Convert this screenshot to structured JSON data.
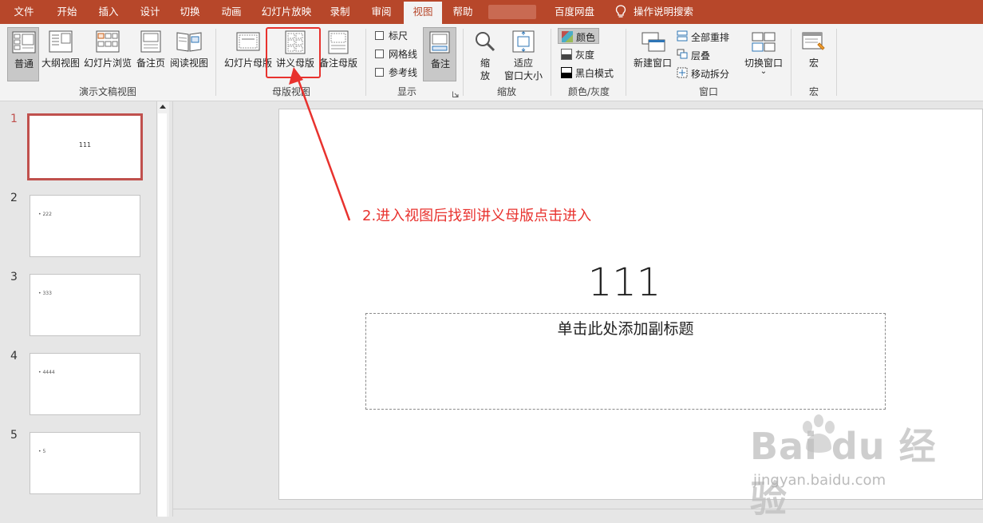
{
  "tabs": [
    {
      "label": "文件"
    },
    {
      "label": "开始"
    },
    {
      "label": "插入"
    },
    {
      "label": "设计"
    },
    {
      "label": "切换"
    },
    {
      "label": "动画"
    },
    {
      "label": "幻灯片放映"
    },
    {
      "label": "录制"
    },
    {
      "label": "审阅"
    },
    {
      "label": "视图"
    },
    {
      "label": "帮助"
    },
    {
      "label": "百度网盘"
    }
  ],
  "tell_me": "操作说明搜索",
  "ribbon": {
    "presentation_views": {
      "label": "演示文稿视图",
      "normal": "普通",
      "outline": "大纲视图",
      "sorter": "幻灯片浏览",
      "notes_page": "备注页",
      "reading": "阅读视图"
    },
    "master_views": {
      "label": "母版视图",
      "slide_master": "幻灯片母版",
      "handout_master": "讲义母版",
      "notes_master": "备注母版"
    },
    "show": {
      "label": "显示",
      "ruler": "标尺",
      "gridlines": "网格线",
      "guides": "参考线",
      "notes": "备注"
    },
    "zoom": {
      "label": "缩放",
      "zoom_line1": "缩",
      "zoom_line2": "放",
      "fit_line1": "适应",
      "fit_line2": "窗口大小"
    },
    "color": {
      "label": "颜色/灰度",
      "color": "颜色",
      "grayscale": "灰度",
      "bw": "黑白模式"
    },
    "window": {
      "label": "窗口",
      "new_window": "新建窗口",
      "arrange_all": "全部重排",
      "cascade": "层叠",
      "move_split": "移动拆分",
      "switch_windows": "切换窗口",
      "switch_arrow": "⌄"
    },
    "macros": {
      "label": "宏",
      "macros": "宏"
    }
  },
  "thumbnails": [
    {
      "num": "1",
      "text": "111"
    },
    {
      "num": "2",
      "text": "• 222"
    },
    {
      "num": "3",
      "text": "• 333"
    },
    {
      "num": "4",
      "text": "• 4444"
    },
    {
      "num": "5",
      "text": "• 5"
    }
  ],
  "slide": {
    "title": "111",
    "subtitle_placeholder": "单击此处添加副标题"
  },
  "annotation": {
    "text": "2.进入视图后找到讲义母版点击进入"
  },
  "watermark": {
    "brand": "Bai  du 经验",
    "sub": "jingyan.baidu.com"
  },
  "colors": {
    "accent": "#b7472a",
    "annotation": "#e8322e",
    "selection": "#c0504d"
  }
}
